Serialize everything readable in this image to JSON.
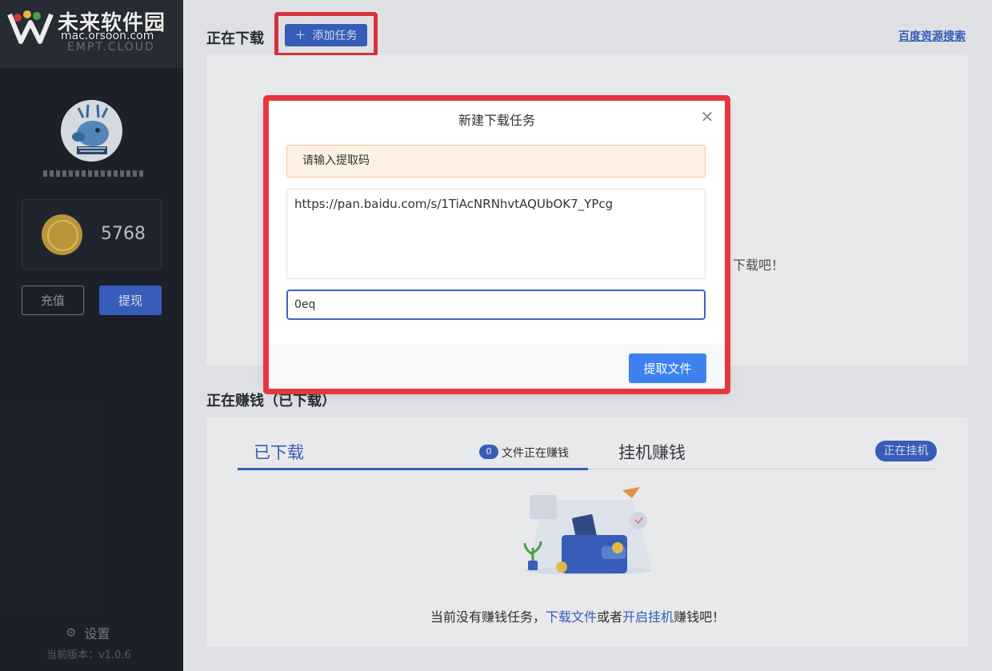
{
  "watermark": {
    "title": "未来软件园",
    "url": "mac.orsoon.com",
    "brand_sub": "EMPT.CLOUD"
  },
  "sidebar": {
    "coin_balance": "5768",
    "recharge_label": "充值",
    "withdraw_label": "提现",
    "settings_label": "设置",
    "version": "当前版本：v1.0.6",
    "icons": {
      "settings": "gear-icon",
      "coin": "coin-icon"
    }
  },
  "downloading": {
    "title": "正在下载",
    "add_task_label": "添加任务",
    "baidu_search_link": "百度资源搜索",
    "empty_hint_tail": "下载吧！"
  },
  "earning": {
    "title": "正在赚钱（已下载）",
    "tabs": [
      {
        "label": "已下载",
        "active": true,
        "badge": "0",
        "badge_text": "文件正在赚钱"
      },
      {
        "label": "挂机赚钱",
        "active": false,
        "pill": "正在挂机"
      }
    ],
    "empty": {
      "prefix": "当前没有赚钱任务，",
      "link1": "下载文件",
      "middle": "或者",
      "link2": "开启挂机",
      "suffix": "赚钱吧！"
    }
  },
  "dialog": {
    "title": "新建下载任务",
    "alert": "请输入提取码",
    "url_value": "https://pan.baidu.com/s/1TiAcNRNhvtAQUbOK7_YPcg",
    "code_value": "0eq",
    "submit_label": "提取文件"
  },
  "colors": {
    "accent": "#3c64c8",
    "highlight": "#e8363f",
    "sidebar_bg": "#1f232c"
  }
}
